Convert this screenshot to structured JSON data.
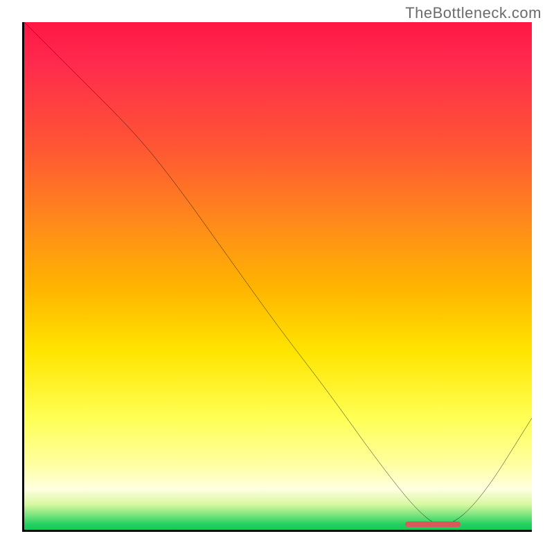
{
  "watermark": "TheBottleneck.com",
  "chart_data": {
    "type": "line",
    "note": "Axes have no tick labels in the screenshot; values are normalized 0–100 on both axes, estimated from pixel positions.",
    "xlabel": "",
    "ylabel": "",
    "xlim": [
      0,
      100
    ],
    "ylim": [
      0,
      100
    ],
    "series": [
      {
        "name": "bottleneck-curve",
        "x": [
          0,
          10,
          22,
          30,
          40,
          50,
          60,
          70,
          78,
          83,
          90,
          100
        ],
        "y": [
          100,
          90,
          78,
          68,
          54,
          40,
          27,
          13,
          3,
          0,
          6,
          22
        ]
      }
    ],
    "annotations": [
      {
        "name": "optimal-range-marker",
        "x_start": 75,
        "x_end": 86,
        "y": 0
      }
    ],
    "background_gradient": {
      "direction": "top-to-bottom",
      "stops": [
        {
          "pos": 0.0,
          "color": "#ff1744"
        },
        {
          "pos": 0.25,
          "color": "#ff5733"
        },
        {
          "pos": 0.5,
          "color": "#ffb300"
        },
        {
          "pos": 0.75,
          "color": "#ffff55"
        },
        {
          "pos": 0.92,
          "color": "#ffffe0"
        },
        {
          "pos": 1.0,
          "color": "#20d060"
        }
      ]
    }
  }
}
